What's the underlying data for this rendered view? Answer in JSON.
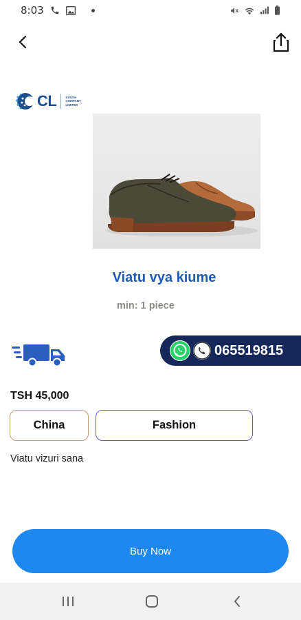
{
  "status_bar": {
    "time": "8:03",
    "icons": [
      "call-icon",
      "image-icon",
      "dot-icon",
      "mute-icon",
      "wifi-icon",
      "signal-icon",
      "battery-icon"
    ]
  },
  "app_bar": {
    "back_icon": "arrow-left-icon",
    "share_icon": "share-icon"
  },
  "product": {
    "logo": {
      "brand": "CL",
      "subtext": [
        "SYNTH",
        "COMPANY",
        "LIMITED"
      ]
    },
    "title": "Viatu vya kiume",
    "min_order": "min: 1 piece",
    "price": "TSH 45,000",
    "origin_tag": "China",
    "category_tag": "Fashion",
    "description": "Viatu vizuri sana"
  },
  "contact": {
    "phone_number": "065519815",
    "whatsapp_icon": "whatsapp-icon",
    "phone_icon": "phone-icon"
  },
  "delivery_icon": "delivery-truck-icon",
  "actions": {
    "buy_now": "Buy Now"
  },
  "nav_bar": {
    "icons": [
      "recent-apps-icon",
      "home-icon",
      "back-icon"
    ]
  },
  "colors": {
    "primary_blue": "#1e88f0",
    "title_blue": "#1c5bb5",
    "contact_navy": "#16285a",
    "origin_border": "#c79a6b",
    "category_border": "#6b57c7"
  }
}
